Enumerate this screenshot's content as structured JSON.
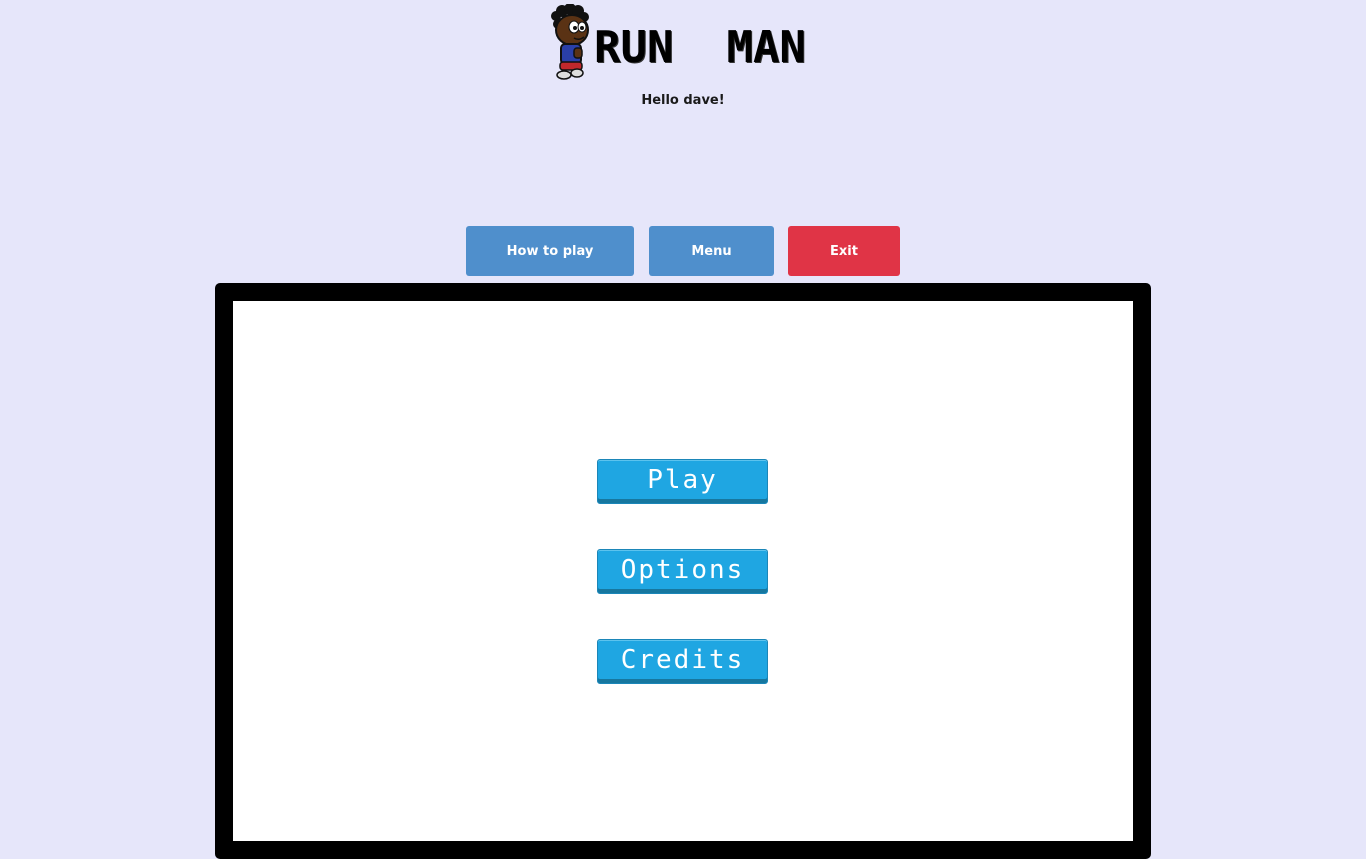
{
  "header": {
    "logo_text": "RUN  MAN",
    "greeting": "Hello dave!"
  },
  "nav": {
    "how_to_play": "How to play",
    "menu": "Menu",
    "exit": "Exit"
  },
  "game_menu": {
    "play": "Play",
    "options": "Options",
    "credits": "Credits"
  },
  "colors": {
    "background": "#e6e6fa",
    "nav_button": "#4f8fcc",
    "exit_button": "#e03446",
    "game_button": "#1fa6e2",
    "frame": "#000000"
  },
  "icons": {
    "logo_character": "run-man-character-icon"
  }
}
